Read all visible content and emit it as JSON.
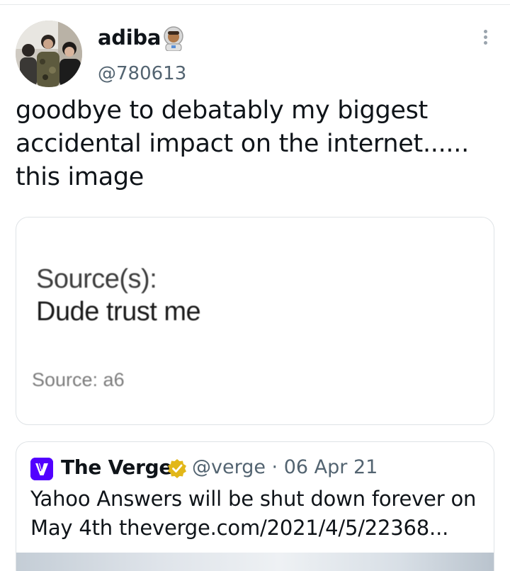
{
  "tweet": {
    "display_name": "adiba",
    "name_emoji": "astronaut-emoji",
    "handle": "@780613",
    "text": "goodbye to debatably my biggest\naccidental impact on the internet......\nthis image",
    "more_icon": "more-dots-icon",
    "media": {
      "sources_label": "Source(s):",
      "answer": "Dude trust me",
      "source_line": "Source: a6"
    }
  },
  "quote": {
    "logo_icon": "verge-logo-icon",
    "name": "The Verge",
    "verified_icon": "verified-gold-badge-icon",
    "handle": "@verge",
    "separator": "·",
    "date": "06 Apr 21",
    "handle_date": "@verge · 06 Apr 21",
    "text": "Yahoo Answers will be shut down forever on May 4th theverge.com/2021/4/5/22368..."
  },
  "colors": {
    "text": "#0f1419",
    "secondary": "#536471",
    "border": "#dfe3e6",
    "verge_purple": "#5200ff",
    "verified_gold": "#e2b719"
  }
}
